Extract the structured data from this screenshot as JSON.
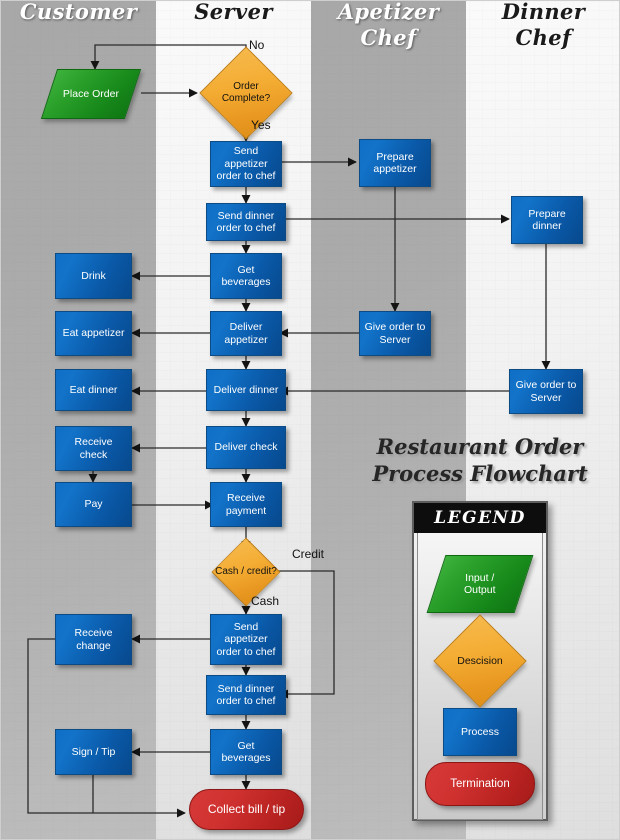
{
  "title": "Restaurant Order\nProcess Flowchart",
  "title_line1": "Restaurant Order",
  "title_line2": "Process Flowchart",
  "colors": {
    "process": "#0a59a8",
    "decision": "#f0a830",
    "input_output": "#1f9a22",
    "termination": "#c02a28",
    "lane_gray": "#ababab",
    "lane_light": "#efefef",
    "connector": "#1a1a1a"
  },
  "lanes": [
    {
      "id": "customer",
      "label": "Customer",
      "shade": "gray"
    },
    {
      "id": "server",
      "label": "Server",
      "shade": "light"
    },
    {
      "id": "appetizer_chef",
      "label": "Apetizer\nChef",
      "line1": "Apetizer",
      "line2": "Chef",
      "shade": "gray"
    },
    {
      "id": "dinner_chef",
      "label": "Dinner\nChef",
      "line1": "Dinner",
      "line2": "Chef",
      "shade": "light"
    }
  ],
  "nodes": [
    {
      "id": "place-order",
      "label": "Place Order",
      "shape": "input-output",
      "lane": "customer"
    },
    {
      "id": "order-complete",
      "label": "Order\nComplete?",
      "shape": "decision",
      "lane": "server"
    },
    {
      "id": "send-appetizer-order",
      "label": "Send\nappetizer\norder to chef",
      "shape": "process",
      "lane": "server"
    },
    {
      "id": "send-dinner-order",
      "label": "Send dinner\norder to chef",
      "shape": "process",
      "lane": "server"
    },
    {
      "id": "get-beverages",
      "label": "Get\nbeverages",
      "shape": "process",
      "lane": "server"
    },
    {
      "id": "deliver-appetizer",
      "label": "Deliver\nappetizer",
      "shape": "process",
      "lane": "server"
    },
    {
      "id": "deliver-dinner",
      "label": "Deliver dinner",
      "shape": "process",
      "lane": "server"
    },
    {
      "id": "deliver-check",
      "label": "Deliver check",
      "shape": "process",
      "lane": "server"
    },
    {
      "id": "receive-payment",
      "label": "Receive\npayment",
      "shape": "process",
      "lane": "server"
    },
    {
      "id": "cash-credit",
      "label": "Cash / credit?",
      "shape": "decision",
      "lane": "server"
    },
    {
      "id": "send-appetizer-order-2",
      "label": "Send\nappetizer\norder to chef",
      "shape": "process",
      "lane": "server"
    },
    {
      "id": "send-dinner-order-2",
      "label": "Send dinner\norder to chef",
      "shape": "process",
      "lane": "server"
    },
    {
      "id": "get-beverages-2",
      "label": "Get\nbeverages",
      "shape": "process",
      "lane": "server"
    },
    {
      "id": "collect-bill-tip",
      "label": "Collect bill / tip",
      "shape": "termination",
      "lane": "server"
    },
    {
      "id": "drink",
      "label": "Drink",
      "shape": "process",
      "lane": "customer"
    },
    {
      "id": "eat-appetizer",
      "label": "Eat appetizer",
      "shape": "process",
      "lane": "customer"
    },
    {
      "id": "eat-dinner",
      "label": "Eat dinner",
      "shape": "process",
      "lane": "customer"
    },
    {
      "id": "receive-check",
      "label": "Receive\ncheck",
      "shape": "process",
      "lane": "customer"
    },
    {
      "id": "pay",
      "label": "Pay",
      "shape": "process",
      "lane": "customer"
    },
    {
      "id": "receive-change",
      "label": "Receive\nchange",
      "shape": "process",
      "lane": "customer"
    },
    {
      "id": "sign-tip",
      "label": "Sign / Tip",
      "shape": "process",
      "lane": "customer"
    },
    {
      "id": "prepare-appetizer",
      "label": "Prepare\nappetizer",
      "shape": "process",
      "lane": "appetizer_chef"
    },
    {
      "id": "give-order-to-server-a",
      "label": "Give order to\nServer",
      "shape": "process",
      "lane": "appetizer_chef"
    },
    {
      "id": "prepare-dinner",
      "label": "Prepare\ndinner",
      "shape": "process",
      "lane": "dinner_chef"
    },
    {
      "id": "give-order-to-server-d",
      "label": "Give order to\nServer",
      "shape": "process",
      "lane": "dinner_chef"
    }
  ],
  "edge_labels": [
    {
      "id": "no",
      "text": "No"
    },
    {
      "id": "yes",
      "text": "Yes"
    },
    {
      "id": "credit",
      "text": "Credit"
    },
    {
      "id": "cash",
      "text": "Cash"
    }
  ],
  "legend": {
    "header": "LEGEND",
    "items": [
      {
        "id": "input-output",
        "label": "Input /\nOutput",
        "line1": "Input /",
        "line2": "Output",
        "shape": "parallelogram",
        "color": "#1f9a22"
      },
      {
        "id": "decision",
        "label": "Descision",
        "shape": "diamond",
        "color": "#f0a830"
      },
      {
        "id": "process",
        "label": "Process",
        "shape": "rectangle",
        "color": "#0a59a8"
      },
      {
        "id": "termination",
        "label": "Termination",
        "shape": "rounded",
        "color": "#c02a28"
      }
    ]
  }
}
